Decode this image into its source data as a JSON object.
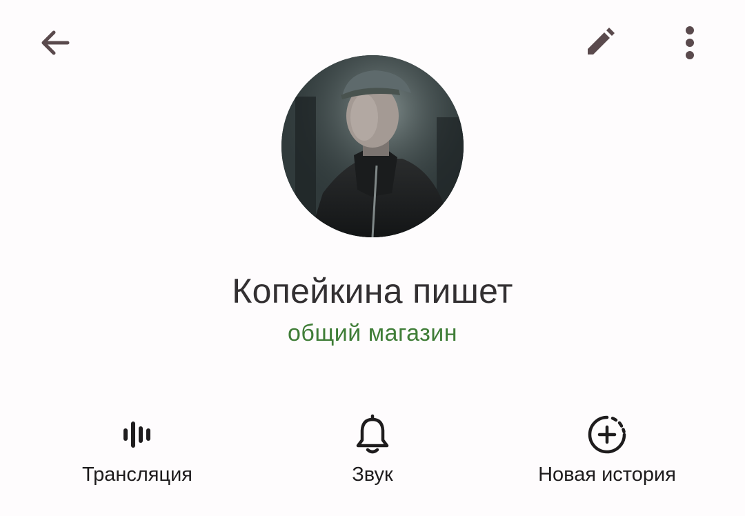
{
  "header": {
    "back_icon": "arrow-left-icon",
    "edit_icon": "pencil-icon",
    "more_icon": "more-vertical-icon"
  },
  "profile": {
    "name": "Копейкина пишет",
    "status": "общий магазин",
    "status_color": "#3f7d37"
  },
  "actions": [
    {
      "label": "Трансляция",
      "icon": "live-stream-icon"
    },
    {
      "label": "Звук",
      "icon": "bell-icon"
    },
    {
      "label": "Новая история",
      "icon": "add-story-icon"
    }
  ]
}
